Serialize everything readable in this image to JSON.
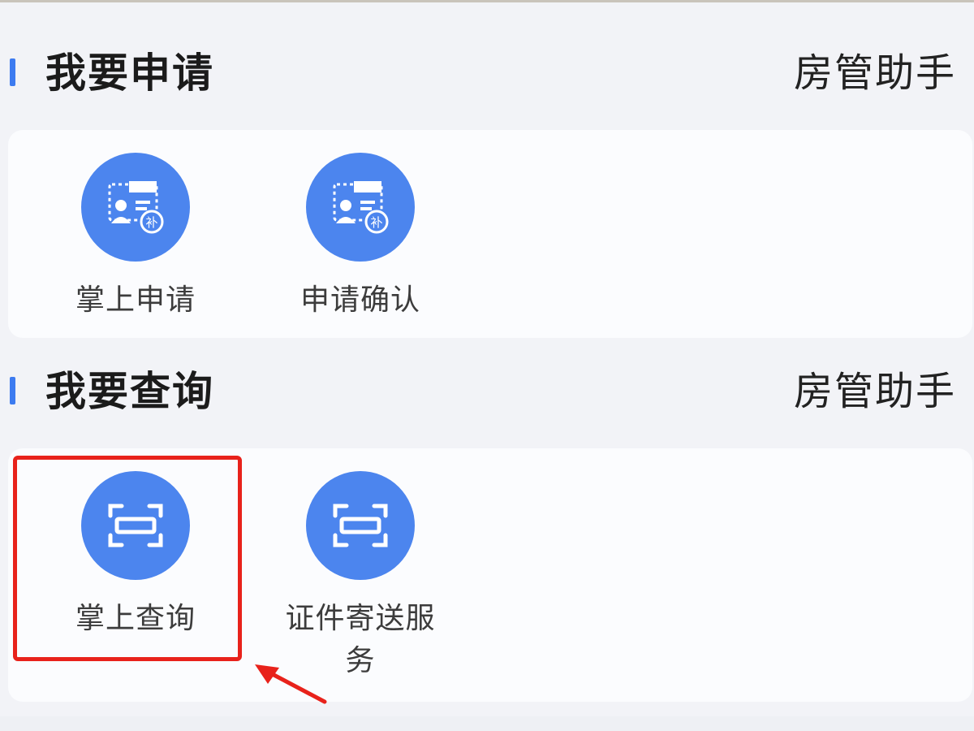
{
  "sections": [
    {
      "title": "我要申请",
      "link": "房管助手",
      "tiles": [
        {
          "label": "掌上申请",
          "icon": "id-card-icon"
        },
        {
          "label": "申请确认",
          "icon": "id-card-icon"
        }
      ]
    },
    {
      "title": "我要查询",
      "link": "房管助手",
      "tiles": [
        {
          "label": "掌上查询",
          "icon": "scan-icon"
        },
        {
          "label": "证件寄送服务",
          "icon": "scan-icon"
        }
      ]
    }
  ],
  "colors": {
    "accent": "#3d7bf0",
    "icon_circle": "#4c85ee",
    "highlight": "#e8221b"
  }
}
